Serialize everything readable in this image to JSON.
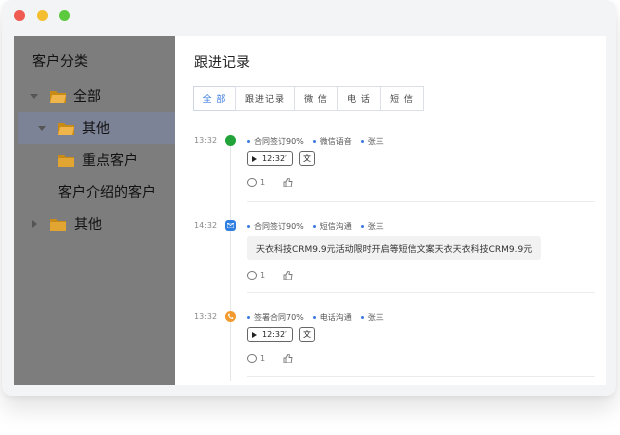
{
  "window": {
    "controls": [
      "close",
      "minimize",
      "maximize"
    ]
  },
  "sidebar": {
    "title": "客户分类",
    "items": [
      {
        "label": "全部",
        "expanded": true,
        "icon": "folder-open-icon"
      },
      {
        "label": "其他",
        "expanded": true,
        "selected": true,
        "icon": "folder-open-icon"
      },
      {
        "label": "重点客户",
        "icon": "folder-icon"
      },
      {
        "label": "客户介绍的客户"
      },
      {
        "label": "其他",
        "expanded": false,
        "icon": "folder-icon"
      }
    ]
  },
  "main": {
    "title": "跟进记录",
    "tabs": [
      {
        "label": "全 部",
        "active": true
      },
      {
        "label": "跟进记录"
      },
      {
        "label": "微 信"
      },
      {
        "label": "电 话"
      },
      {
        "label": "短 信"
      }
    ],
    "entries": [
      {
        "time": "13:32",
        "marker_color": "#22a33a",
        "tags": [
          "合同签订90%",
          "微信语音",
          "张三"
        ],
        "audio": "12:32′",
        "text_button": "文",
        "comments": "1"
      },
      {
        "time": "14:32",
        "marker_color": "#2f7fe0",
        "tags": [
          "合同签订90%",
          "短信沟通",
          "张三"
        ],
        "message": "天衣科技CRM9.9元活动限时开启等短信文案天衣天衣科技CRM9.9元",
        "comments": "1"
      },
      {
        "time": "13:32",
        "marker_color": "#f29a2e",
        "tags": [
          "签署合同70%",
          "电话沟通",
          "张三"
        ],
        "audio": "12:32′",
        "text_button": "文",
        "comments": "1"
      }
    ]
  }
}
